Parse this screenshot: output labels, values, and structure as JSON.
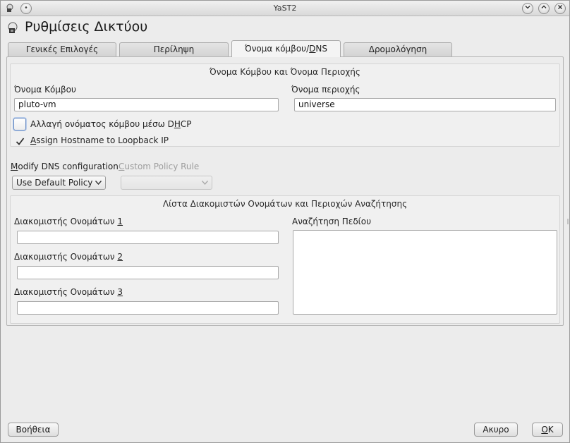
{
  "window": {
    "title": "YaST2"
  },
  "header": {
    "title": "Ρυθμίσεις Δικτύου"
  },
  "tabs": [
    {
      "label": "Γενικές Επιλογές"
    },
    {
      "label": "Περίληψη"
    },
    {
      "label_prefix": "Όνομα κόμβου/",
      "label_mnemonic": "D",
      "label_suffix": "NS"
    },
    {
      "label": "Δρομολόγηση"
    }
  ],
  "hostname_group": {
    "title": "Όνομα Κόμβου και Όνομα Περιοχής",
    "hostname_label": "Όνομα Κόμβου",
    "hostname_value": "pluto-vm",
    "domain_label": "Όνομα περιοχής",
    "domain_value": "universe",
    "dhcp_checkbox": {
      "prefix": "Αλλαγή ονόματος κόμβου μέσω D",
      "mnemonic": "H",
      "suffix": "CP",
      "checked": false
    },
    "loopback_checkbox": {
      "mnemonic": "A",
      "rest": "ssign Hostname to Loopback IP",
      "checked": true
    }
  },
  "dns_config": {
    "modify_label_mnemonic": "M",
    "modify_label_rest": "odify DNS configuration",
    "modify_value": "Use Default Policy",
    "custom_label_mnemonic": "C",
    "custom_label_rest": "ustom Policy Rule",
    "custom_value": ""
  },
  "nameserver_group": {
    "title": "Λίστα Διακομιστών Ονομάτων και Περιοχών Αναζήτησης",
    "ns_prefix": "Διακομιστής Ονομάτων ",
    "ns1_num": "1",
    "ns2_num": "2",
    "ns3_num": "3",
    "ns1_value": "",
    "ns2_value": "",
    "ns3_value": "",
    "search_label": "Αναζήτηση Πεδίου",
    "search_value": ""
  },
  "footer": {
    "help_label": "Βοήθεια",
    "cancel_label": "Ακυρο",
    "ok_mnemonic": "O",
    "ok_rest": "K"
  },
  "colors": {
    "accent": "#6a8dc4",
    "window_bg": "#ececec"
  }
}
